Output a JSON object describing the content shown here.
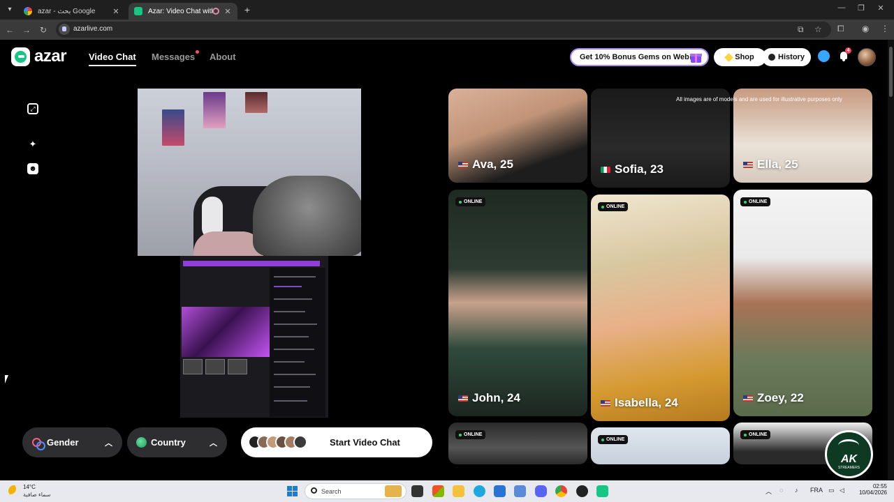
{
  "browser": {
    "tabs": [
      {
        "title": "azar - بحث Google",
        "active": false
      },
      {
        "title": "Azar: Video Chat with New",
        "active": true
      }
    ],
    "url": "azarlive.com"
  },
  "header": {
    "logo": "azar",
    "nav": [
      {
        "label": "Video Chat",
        "active": true
      },
      {
        "label": "Messages",
        "active": false
      },
      {
        "label": "About",
        "active": false
      }
    ],
    "promo": "Get 10% Bonus Gems on Web!",
    "shop": "Shop",
    "history": "History",
    "notification_count": "4"
  },
  "controls": {
    "gender": "Gender",
    "country": "Country",
    "start": "Start Video Chat"
  },
  "gallery": {
    "disclaimer": "All images are of models and are used for illustrative purposes only",
    "online_label": "ONLINE",
    "profiles": [
      {
        "name": "Ava, 25",
        "flag": "us"
      },
      {
        "name": "Sofia, 23",
        "flag": "it"
      },
      {
        "name": "Ella, 25",
        "flag": "us"
      },
      {
        "name": "John, 24",
        "flag": "us"
      },
      {
        "name": "Isabella, 24",
        "flag": "us"
      },
      {
        "name": "Zoey, 22",
        "flag": "us"
      }
    ]
  },
  "watermark": {
    "title": "AK",
    "subtitle": "STREAMERS"
  },
  "taskbar": {
    "temperature": "14°C",
    "condition": "سماء صافية",
    "search": "Search",
    "lang": "FRA",
    "time": "02:55",
    "date": "10/04/2026"
  },
  "colors": {
    "accent": "#16c783",
    "online_dot": "#36d27a",
    "promo_border": "#a98bf0"
  }
}
